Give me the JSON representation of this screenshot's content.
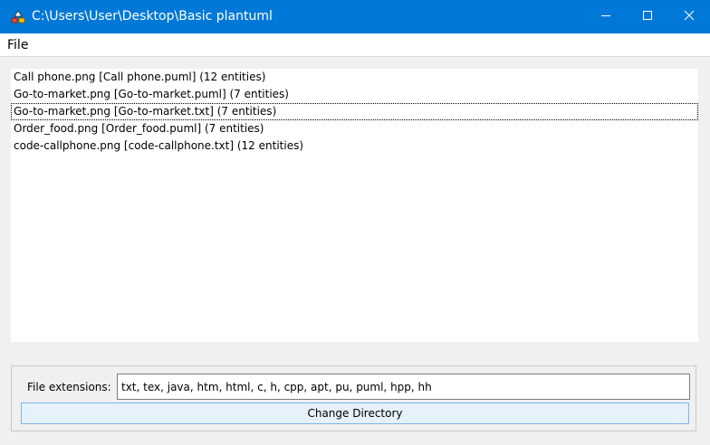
{
  "window": {
    "title": "C:\\Users\\User\\Desktop\\Basic plantuml",
    "app_icon": "plantuml-app-icon",
    "accent_color": "#0078d7"
  },
  "menu": {
    "items": [
      {
        "label": "File"
      }
    ]
  },
  "file_list": {
    "items": [
      {
        "label": "Call phone.png [Call phone.puml] (12 entities)"
      },
      {
        "label": "Go-to-market.png [Go-to-market.puml] (7 entities)"
      },
      {
        "label": "Go-to-market.png [Go-to-market.txt] (7 entities)",
        "selected": true
      },
      {
        "label": "Order_food.png [Order_food.puml] (7 entities)"
      },
      {
        "label": "code-callphone.png [code-callphone.txt] (12 entities)"
      }
    ]
  },
  "settings": {
    "extensions_label": "File extensions:",
    "extensions_value": "txt, tex, java, htm, html, c, h, cpp, apt, pu, puml, hpp, hh",
    "change_directory_label": "Change Directory"
  }
}
